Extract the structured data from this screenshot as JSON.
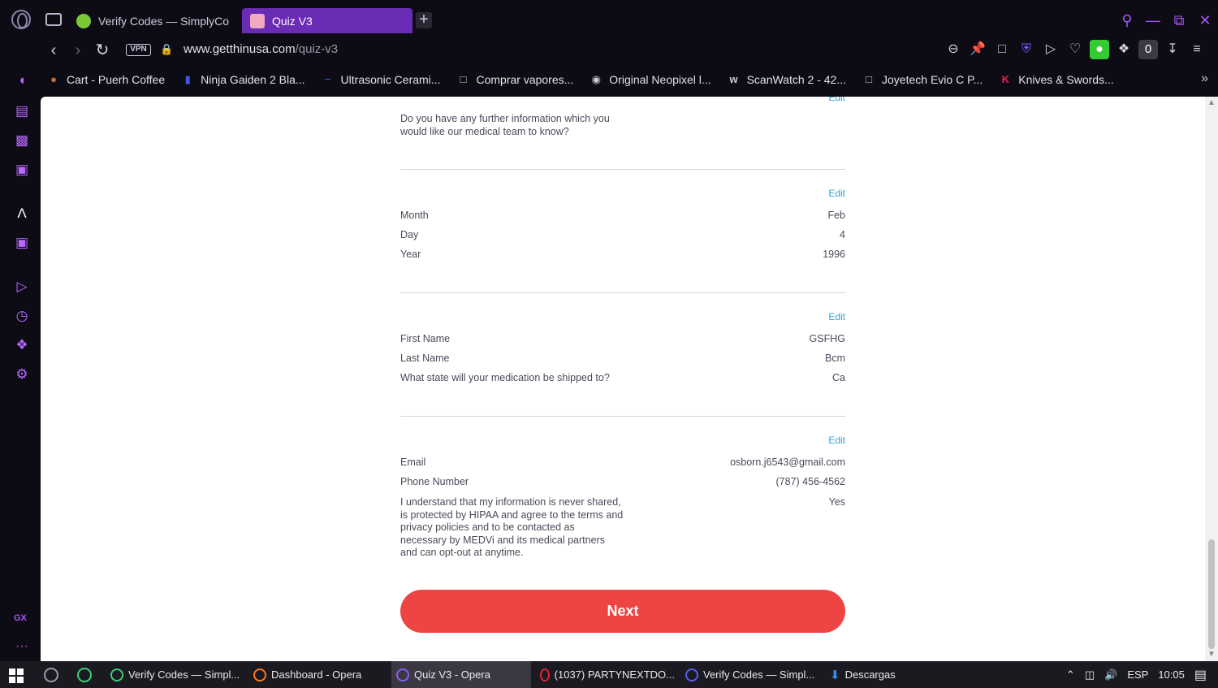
{
  "browser": {
    "tabs": [
      {
        "label": "Verify Codes — SimplyCo",
        "active": false
      },
      {
        "label": "Quiz V3",
        "active": true
      }
    ],
    "url_host": "www.getthinusa.com",
    "url_path": "/quiz-v3",
    "vpn_label": "VPN",
    "badge_count": "0",
    "bookmarks": [
      {
        "label": "Cart - Puerh Coffee",
        "icon": "coffee-icon"
      },
      {
        "label": "Ninja Gaiden 2 Bla...",
        "icon": "gamepad-icon"
      },
      {
        "label": "Ultrasonic Cerami...",
        "icon": "knife-icon"
      },
      {
        "label": "Comprar vapores...",
        "icon": "page-icon"
      },
      {
        "label": "Original Neopixel l...",
        "icon": "globe-icon"
      },
      {
        "label": "ScanWatch 2 - 42...",
        "icon": "w-logo-icon"
      },
      {
        "label": "Joyetech Evio C P...",
        "icon": "page-icon"
      },
      {
        "label": "Knives & Swords...",
        "icon": "k-logo-icon"
      }
    ]
  },
  "sidebar": {
    "gx_label": "GX",
    "more_label": "···"
  },
  "summary": {
    "section0": {
      "edit": "Edit",
      "question": "Do you have any further information which you would like our medical team to know?"
    },
    "section1": {
      "edit": "Edit",
      "rows": [
        {
          "q": "Month",
          "a": "Feb"
        },
        {
          "q": "Day",
          "a": "4"
        },
        {
          "q": "Year",
          "a": "1996"
        }
      ]
    },
    "section2": {
      "edit": "Edit",
      "rows": [
        {
          "q": "First Name",
          "a": "GSFHG"
        },
        {
          "q": "Last Name",
          "a": "Bcm"
        },
        {
          "q": "What state will your medication be shipped to?",
          "a": "Ca"
        }
      ]
    },
    "section3": {
      "edit": "Edit",
      "rows": [
        {
          "q": "Email",
          "a": "osborn.j6543@gmail.com"
        },
        {
          "q": "Phone Number",
          "a": "(787) 456-4562"
        },
        {
          "q": "I understand that my information is never shared, is protected by HIPAA and agree to the terms and privacy policies and to be contacted as necessary by MEDVi and its medical partners and can opt-out at anytime.",
          "a": "Yes"
        }
      ]
    },
    "next_label": "Next"
  },
  "taskbar": {
    "apps": [
      {
        "label": "Verify Codes — Simpl...",
        "active": false
      },
      {
        "label": "Dashboard - Opera",
        "active": false
      },
      {
        "label": "Quiz V3 - Opera",
        "active": true
      },
      {
        "label": "(1037) PARTYNEXTDO...",
        "active": false
      },
      {
        "label": "Verify Codes — Simpl...",
        "active": false
      },
      {
        "label": "Descargas",
        "active": false
      }
    ],
    "language": "ESP",
    "time": "10:05"
  },
  "colors": {
    "accent": "#a855f7",
    "active_tab": "#6a2bb5",
    "edit_link": "#2aa6d6",
    "next_button": "#ef4444"
  }
}
